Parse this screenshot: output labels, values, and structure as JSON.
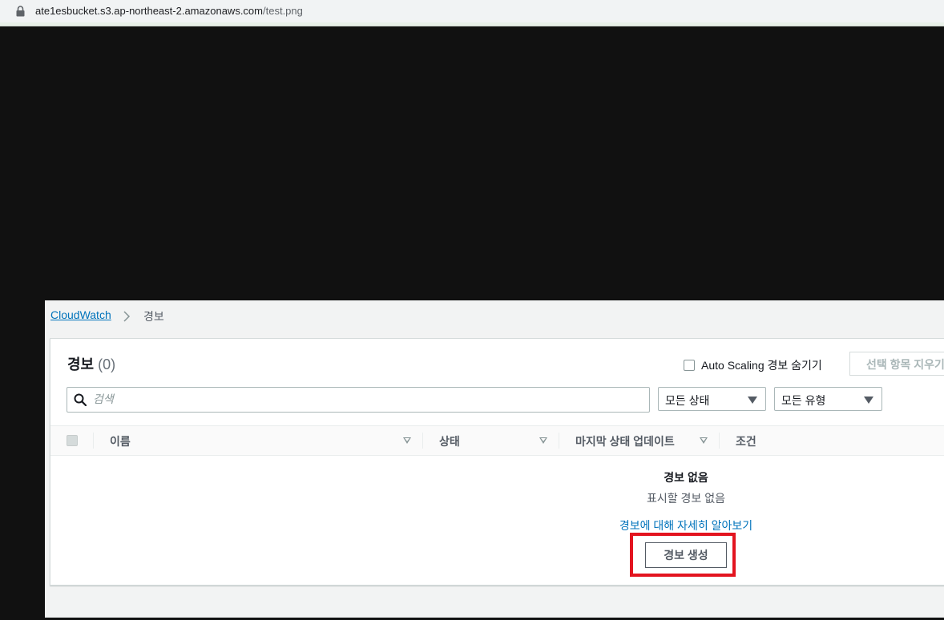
{
  "browser": {
    "url_host": "ate1esbucket.s3.ap-northeast-2.amazonaws.com",
    "url_path": "/test.png"
  },
  "breadcrumb": {
    "root": "CloudWatch",
    "current": "경보"
  },
  "panel": {
    "title": "경보",
    "count": "(0)",
    "auto_scaling_label": "Auto Scaling 경보 숨기기",
    "auto_scaling_checked": false,
    "clear_button": "선택 항목 지우기"
  },
  "search": {
    "placeholder": "검색",
    "value": ""
  },
  "filters": {
    "status": "모든 상태",
    "type": "모든 유형"
  },
  "table": {
    "columns": [
      "이름",
      "상태",
      "마지막 상태 업데이트",
      "조건"
    ]
  },
  "empty": {
    "title": "경보 없음",
    "subtitle": "표시할 경보 없음",
    "learn_more": "경보에 대해 자세히 알아보기",
    "create_button": "경보 생성"
  },
  "colors": {
    "highlight": "#e3141f",
    "link": "#0073bb"
  }
}
